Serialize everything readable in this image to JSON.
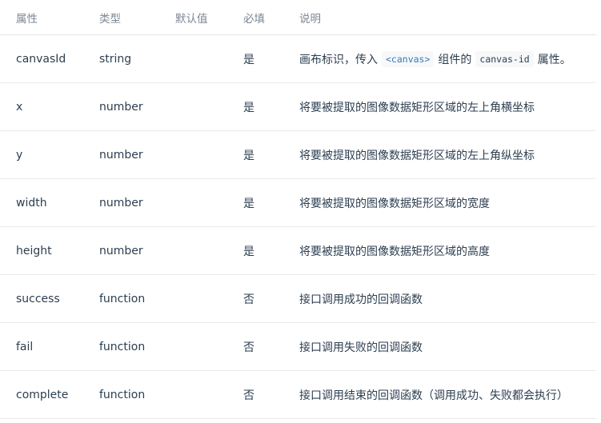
{
  "table": {
    "headers": {
      "name": "属性",
      "type": "类型",
      "default": "默认值",
      "required": "必填",
      "description": "说明"
    },
    "rows": [
      {
        "name": "canvasId",
        "type": "string",
        "default": "",
        "required": "是",
        "description": {
          "before": "画布标识，传入",
          "code1": "<canvas>",
          "middle": "组件的",
          "code2": "canvas-id",
          "after": "属性。"
        }
      },
      {
        "name": "x",
        "type": "number",
        "default": "",
        "required": "是",
        "description": "将要被提取的图像数据矩形区域的左上角横坐标"
      },
      {
        "name": "y",
        "type": "number",
        "default": "",
        "required": "是",
        "description": "将要被提取的图像数据矩形区域的左上角纵坐标"
      },
      {
        "name": "width",
        "type": "number",
        "default": "",
        "required": "是",
        "description": "将要被提取的图像数据矩形区域的宽度"
      },
      {
        "name": "height",
        "type": "number",
        "default": "",
        "required": "是",
        "description": "将要被提取的图像数据矩形区域的高度"
      },
      {
        "name": "success",
        "type": "function",
        "default": "",
        "required": "否",
        "description": "接口调用成功的回调函数"
      },
      {
        "name": "fail",
        "type": "function",
        "default": "",
        "required": "否",
        "description": "接口调用失败的回调函数"
      },
      {
        "name": "complete",
        "type": "function",
        "default": "",
        "required": "否",
        "description": "接口调用结束的回调函数（调用成功、失败都会执行）"
      }
    ]
  }
}
